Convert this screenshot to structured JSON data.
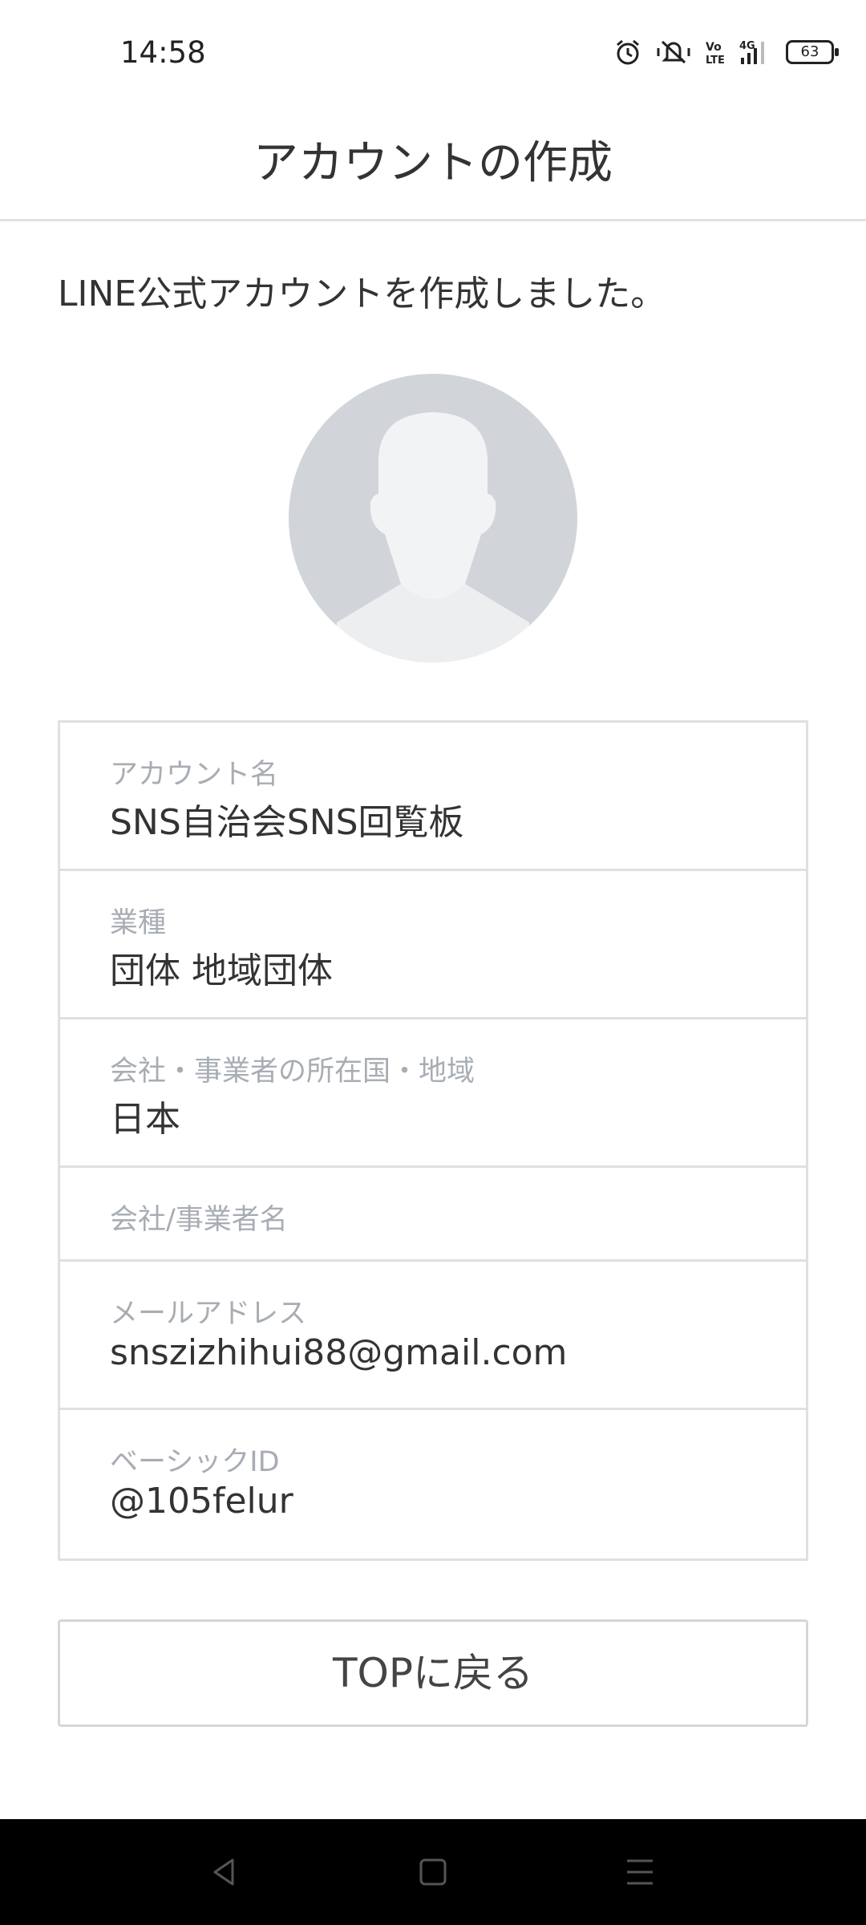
{
  "status_bar": {
    "time": "14:58",
    "battery": "63",
    "icons": [
      "alarm-icon",
      "mute-vibrate-icon",
      "volte-icon",
      "signal-4g-icon",
      "battery-icon"
    ]
  },
  "header": {
    "title": "アカウントの作成"
  },
  "message": "LINE公式アカウントを作成しました。",
  "avatar": {
    "icon": "default-profile-icon"
  },
  "fields": [
    {
      "label": "アカウント名",
      "value": "SNS自治会SNS回覧板"
    },
    {
      "label": "業種",
      "value": "団体 地域団体"
    },
    {
      "label": "会社・事業者の所在国・地域",
      "value": "日本"
    },
    {
      "label": "会社/事業者名",
      "value": ""
    },
    {
      "label": "メールアドレス",
      "value": "snszizhihui88@gmail.com"
    },
    {
      "label": "ベーシックID",
      "value": "@105felur"
    }
  ],
  "top_button": "TOPに戻る",
  "nav": {
    "icons": [
      "back-icon",
      "home-icon",
      "recents-icon"
    ]
  }
}
